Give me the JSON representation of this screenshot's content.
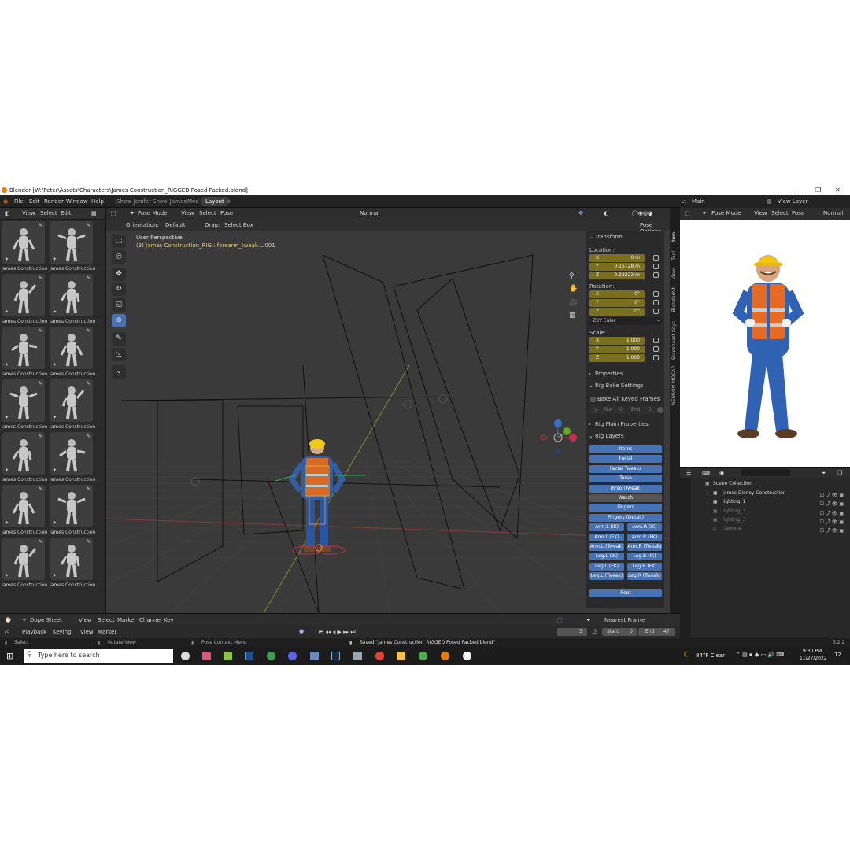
{
  "window": {
    "title": "Blender [W:\\Peter\\Assets\\Characters\\James Construction_RIGGED Posed Packed.blend]",
    "controls": [
      "–",
      "❐",
      "✕"
    ]
  },
  "menu": {
    "items": [
      "File",
      "Edit",
      "Render",
      "Window",
      "Help"
    ],
    "workspaces": [
      "Show-Jenifer",
      "Show-James",
      "Mod",
      "Layout"
    ],
    "active_workspace": "Layout",
    "add_tab": "+",
    "scene_label": "Main",
    "view_layer_label": "View Layer"
  },
  "asset_browser": {
    "header_items": [
      "View",
      "Select",
      "Edit"
    ],
    "item_label": "James Construction",
    "item_count": 14
  },
  "viewport": {
    "mode": "Pose Mode",
    "header_items": [
      "View",
      "Select",
      "Pose"
    ],
    "shading_label": "Normal",
    "orientation_label": "Orientation:",
    "orientation_value": "Default",
    "drag_label": "Drag:",
    "drag_value": "Select Box",
    "pose_options": "Pose Options",
    "overlay_title": "User Perspective",
    "overlay_subtitle": "(3) James Construction_RIG : forearm_tweak.L.001",
    "colors": {
      "selected": "#e8a52c",
      "info_text": "#e5d06c",
      "bg": "#3a3a3a"
    }
  },
  "npanel": {
    "transform_header": "Transform",
    "location_label": "Location:",
    "location": [
      {
        "axis": "X",
        "value": "0 m"
      },
      {
        "axis": "Y",
        "value": "0.15128 m"
      },
      {
        "axis": "Z",
        "value": "-0.23222 m"
      }
    ],
    "rotation_label": "Rotation:",
    "rotation": [
      {
        "axis": "X",
        "value": "0°"
      },
      {
        "axis": "Y",
        "value": "0°"
      },
      {
        "axis": "Z",
        "value": "0°"
      }
    ],
    "rotation_mode": "ZXY Euler",
    "scale_label": "Scale:",
    "scale": [
      {
        "axis": "X",
        "value": "1.000"
      },
      {
        "axis": "Y",
        "value": "1.000"
      },
      {
        "axis": "Z",
        "value": "1.000"
      }
    ],
    "properties": "Properties",
    "rig_bake": "Rig Bake Settings",
    "bake_all": "Bake All Keyed Frames",
    "start_label": "Star",
    "start_value": "0",
    "end_label": "End",
    "end_value": "0",
    "rig_main": "Rig Main Properties",
    "rig_layers": "Rig Layers",
    "layers_full": [
      "Items",
      "Facial",
      "Facial Tweaks",
      "Torso",
      "Torso (Tweak)"
    ],
    "watch": "Watch",
    "layers_full2": [
      "Fingers",
      "Fingers (Detail)"
    ],
    "layer_pairs": [
      [
        "Arm.L (IK)",
        "Arm.R (IK)"
      ],
      [
        "Arm.L (FK)",
        "Arm.R (FK)"
      ],
      [
        "Arm.L (Tweak)",
        "Arm.R (Tweak)"
      ],
      [
        "Leg.L (IK)",
        "Leg.R (IK)"
      ],
      [
        "Leg.L (FK)",
        "Leg.R (FK)"
      ],
      [
        "Leg.L (Tweak)",
        "Leg.R (Tweak)"
      ]
    ],
    "root": "Root",
    "tabs": [
      "Item",
      "Tool",
      "View",
      "BlenderKit",
      "Screencast Keys",
      "NEURON MOCAP"
    ]
  },
  "right_view": {
    "mode": "Pose Mode",
    "header_items": [
      "View",
      "Select",
      "Pose"
    ],
    "shading_label": "Normal"
  },
  "outliner": {
    "root": "Scene Collection",
    "items": [
      {
        "name": "James Disney Construction",
        "dim": false
      },
      {
        "name": "lighting_1",
        "dim": false
      },
      {
        "name": "lighting_2",
        "dim": true
      },
      {
        "name": "lighting_3",
        "dim": true
      },
      {
        "name": "Camera",
        "dim": true
      }
    ]
  },
  "dopesheet": {
    "editor": "Dope Sheet",
    "items": [
      "View",
      "Select",
      "Marker",
      "Channel",
      "Key"
    ],
    "snap": "Nearest Frame"
  },
  "timeline": {
    "playback": "Playback",
    "keying": "Keying",
    "items": [
      "View",
      "Marker"
    ],
    "current_frame": "3",
    "start_label": "Start",
    "start": "0",
    "end_label": "End",
    "end": "47"
  },
  "status": {
    "select": "Select",
    "rotate": "Rotate View",
    "context": "Pose Context Menu",
    "saved": "Saved \"James Construction_RIGGED Posed Packed.blend\"",
    "version": "3.2.2"
  },
  "taskbar": {
    "search_placeholder": "Type here to search",
    "weather": "84°F  Clear",
    "time": "9:30 PM",
    "date": "11/27/2022",
    "notifications": "12"
  }
}
